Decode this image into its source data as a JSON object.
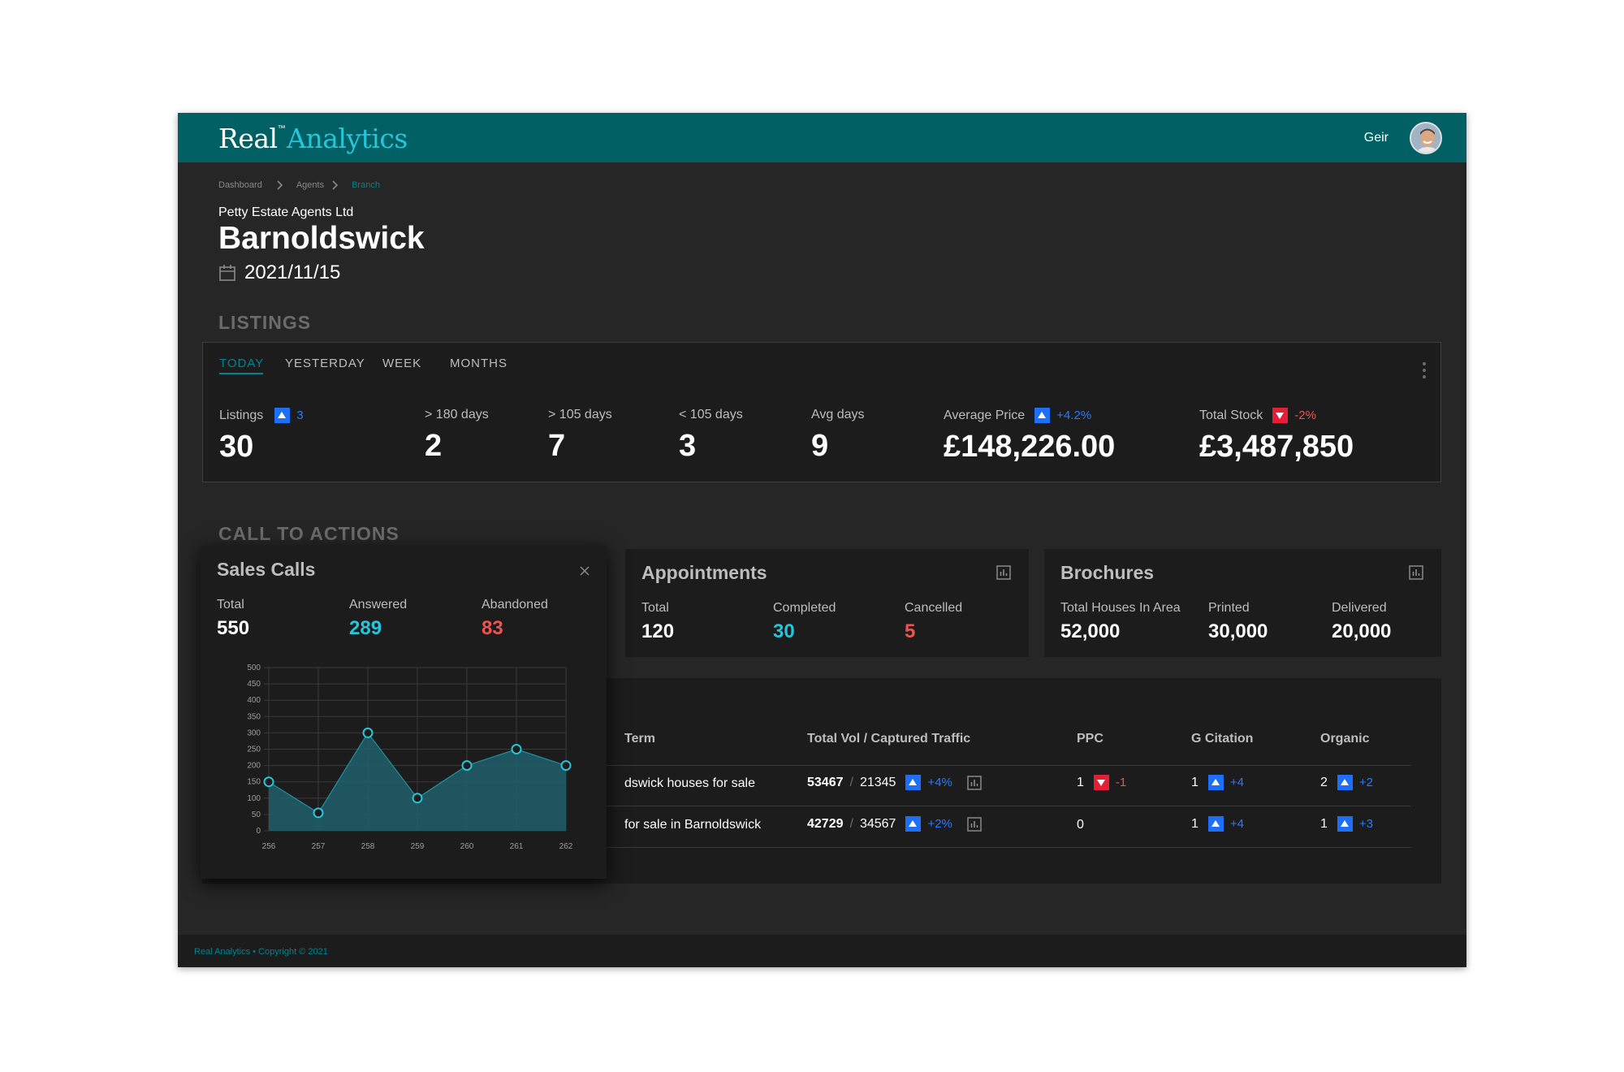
{
  "app": {
    "logo_main": "Real",
    "logo_tm": "™",
    "logo_accent": "Analytics"
  },
  "user": {
    "name": "Geir"
  },
  "breadcrumb": {
    "items": [
      "Dashboard",
      "Agents",
      "Branch"
    ]
  },
  "page": {
    "subtitle": "Petty Estate Agents Ltd",
    "title": "Barnoldswick",
    "date": "2021/11/15"
  },
  "listings": {
    "section_title": "LISTINGS",
    "tabs": [
      "TODAY",
      "YESTERDAY",
      "WEEK",
      "MONTHS"
    ],
    "active_tab": "TODAY",
    "stats": [
      {
        "label": "Listings",
        "value": "30",
        "delta": "3",
        "direction": "up"
      },
      {
        "label": "> 180 days",
        "value": "2"
      },
      {
        "label": "> 105 days",
        "value": "7"
      },
      {
        "label": "< 105 days",
        "value": "3"
      },
      {
        "label": "Avg days",
        "value": "9"
      },
      {
        "label": "Average Price",
        "value": "£148,226.00",
        "delta": "+4.2%",
        "direction": "up"
      },
      {
        "label": "Total Stock",
        "value": "£3,487,850",
        "delta": "-2%",
        "direction": "down"
      }
    ]
  },
  "cta": {
    "section_title": "CALL TO ACTIONS",
    "sales_calls": {
      "title": "Sales Calls",
      "stats": [
        {
          "label": "Total",
          "value": "550"
        },
        {
          "label": "Answered",
          "value": "289"
        },
        {
          "label": "Abandoned",
          "value": "83"
        }
      ]
    },
    "appointments": {
      "title": "Appointments",
      "stats": [
        {
          "label": "Total",
          "value": "120"
        },
        {
          "label": "Completed",
          "value": "30"
        },
        {
          "label": "Cancelled",
          "value": "5"
        }
      ]
    },
    "brochures": {
      "title": "Brochures",
      "stats": [
        {
          "label": "Total Houses In Area",
          "value": "52,000"
        },
        {
          "label": "Printed",
          "value": "30,000"
        },
        {
          "label": "Delivered",
          "value": "20,000"
        }
      ]
    }
  },
  "search_table": {
    "headers": [
      "Term",
      "Total Vol / Captured Traffic",
      "PPC",
      "G Citation",
      "Organic"
    ],
    "rows": [
      {
        "term": "dswick houses for sale",
        "total_vol": "53467",
        "captured": "21345",
        "vol_delta": "+4%",
        "vol_dir": "up",
        "ppc": "1",
        "ppc_delta": "-1",
        "ppc_dir": "down",
        "citation": "1",
        "citation_delta": "+4",
        "citation_dir": "up",
        "organic": "2",
        "organic_delta": "+2",
        "organic_dir": "up"
      },
      {
        "term": "for sale in Barnoldswick",
        "total_vol": "42729",
        "captured": "34567",
        "vol_delta": "+2%",
        "vol_dir": "up",
        "ppc": "0",
        "citation": "1",
        "citation_delta": "+4",
        "citation_dir": "up",
        "organic": "1",
        "organic_delta": "+3",
        "organic_dir": "up"
      }
    ]
  },
  "chart_data": {
    "type": "area",
    "x": [
      "256",
      "257",
      "258",
      "259",
      "260",
      "261",
      "262"
    ],
    "values": [
      150,
      55,
      300,
      100,
      200,
      250,
      200
    ],
    "ylim": [
      0,
      500
    ],
    "yticks": [
      0,
      50,
      100,
      150,
      200,
      250,
      300,
      350,
      400,
      450,
      500
    ],
    "grid": true,
    "colors": {
      "fill": "#1f5f6b",
      "line": "#26c6da",
      "point": "#26c6da",
      "grid": "#3a3a3a"
    }
  },
  "footer": {
    "text": "Real Analytics • Copyright © 2021"
  },
  "colors": {
    "brand": "#006064",
    "accent": "#26c6da",
    "up": "#2979ff",
    "down": "#ef5350"
  }
}
